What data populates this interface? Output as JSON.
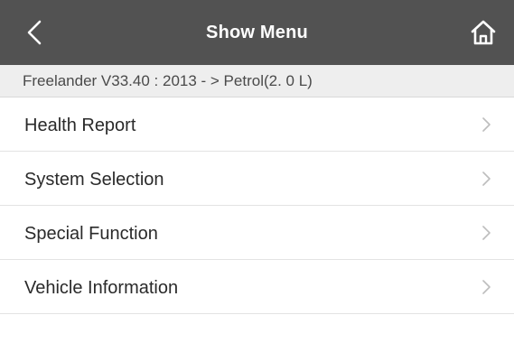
{
  "header": {
    "title": "Show Menu",
    "back_icon": "chevron-left-icon",
    "home_icon": "home-icon",
    "background_color": "#525252"
  },
  "vehicle": {
    "info": "Freelander V33.40 : 2013 - > Petrol(2. 0 L)"
  },
  "menu": {
    "items": [
      {
        "label": "Health Report",
        "icon": "chevron-right-icon"
      },
      {
        "label": "System Selection",
        "icon": "chevron-right-icon"
      },
      {
        "label": "Special Function",
        "icon": "chevron-right-icon"
      },
      {
        "label": "Vehicle Information",
        "icon": "chevron-right-icon"
      }
    ]
  }
}
